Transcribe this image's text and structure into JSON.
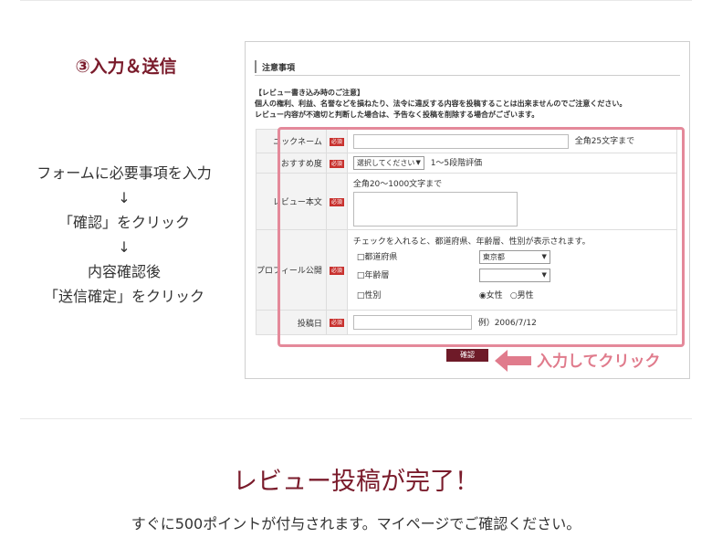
{
  "step": {
    "title": "③入力＆送信",
    "lines": [
      "フォームに必要事項を入力",
      "↓",
      "「確認」をクリック",
      "↓",
      "内容確認後",
      "「送信確定」をクリック"
    ]
  },
  "screenshot": {
    "notice_heading": "注意事項",
    "notice_lines": [
      "【レビュー書き込み時のご注意】",
      "個人の権利、利益、名誉などを損ねたり、法令に違反する内容を投稿することは出来ませんのでご注意ください。",
      "レビュー内容が不適切と判断した場合は、予告なく投稿を削除する場合がございます。"
    ],
    "required_badge": "必須",
    "nickname": {
      "label": "ニックネーム",
      "note": "全角25文字まで"
    },
    "recommend": {
      "label": "おすすめ度",
      "select_value": "選択してください",
      "note": "1〜5段階評価"
    },
    "review": {
      "label": "レビュー本文",
      "note": "全角20〜1000文字まで"
    },
    "profile": {
      "label": "プロフィール公開",
      "note": "チェックを入れると、都道府県、年齢層、性別が表示されます。",
      "prefecture_label": "□都道府県",
      "prefecture_value": "東京都",
      "age_label": "□年齢層",
      "age_value": "",
      "gender_label": "□性別",
      "female": "◉女性",
      "male": "○男性"
    },
    "post_date": {
      "label": "投稿日",
      "example": "例）2006/7/12"
    },
    "confirm_label": "確認"
  },
  "callout": "入力してクリック",
  "complete_title": "レビュー投稿が完了！",
  "complete_text": "すぐに500ポイントが付与されます。マイページでご確認ください。",
  "colors": {
    "accent": "#7a1b2b",
    "highlight": "#e4899a",
    "required": "#c8322f"
  }
}
